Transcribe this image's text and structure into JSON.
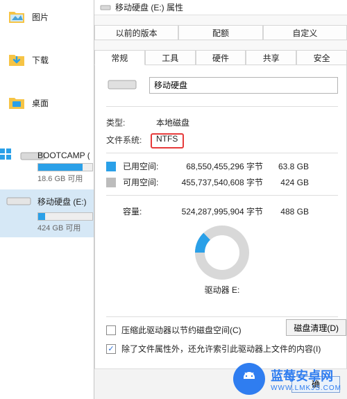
{
  "sidebar": {
    "nav": {
      "pictures": "图片",
      "downloads": "下载",
      "desktop": "桌面"
    },
    "drives": {
      "bootcamp": {
        "title": "BOOTCAMP (",
        "sub": "18.6 GB 可用",
        "fill_pct": 82
      },
      "removable": {
        "title": "移动硬盘 (E:)",
        "sub": "424 GB 可用",
        "fill_pct": 13
      }
    }
  },
  "dialog": {
    "title": "移动硬盘 (E:) 属性",
    "tabs_top": {
      "prev": "以前的版本",
      "quota": "配额",
      "custom": "自定义"
    },
    "tabs_bottom": {
      "general": "常规",
      "tools": "工具",
      "hardware": "硬件",
      "sharing": "共享",
      "security": "安全"
    },
    "name_value": "移动硬盘",
    "type_label": "类型:",
    "type_value": "本地磁盘",
    "fs_label": "文件系统:",
    "fs_value": "NTFS",
    "used_label": "已用空间:",
    "used_bytes": "68,550,455,296 字节",
    "used_human": "63.8 GB",
    "free_label": "可用空间:",
    "free_bytes": "455,737,540,608 字节",
    "free_human": "424 GB",
    "cap_label": "容量:",
    "cap_bytes": "524,287,995,904 字节",
    "cap_human": "488 GB",
    "drive_label": "驱动器 E:",
    "cleanup_btn": "磁盘清理(D)",
    "chk_compress": "压缩此驱动器以节约磁盘空间(C)",
    "chk_index": "除了文件属性外，还允许索引此驱动器上文件的内容(I)",
    "ok_btn": "确"
  },
  "chart_data": {
    "type": "pie",
    "title": "驱动器 E:",
    "series": [
      {
        "name": "已用空间",
        "value": 68550455296,
        "human": "63.8 GB",
        "color": "#2aa0e8"
      },
      {
        "name": "可用空间",
        "value": 455737540608,
        "human": "424 GB",
        "color": "#bcbcbc"
      }
    ],
    "total": {
      "value": 524287995904,
      "human": "488 GB"
    }
  },
  "icons": {
    "folder_color": "#f6c445",
    "accent": "#2aa0e8",
    "highlight": "#e63a3a"
  },
  "watermark": {
    "text": "蓝莓安卓网",
    "sub": "WWW.LMKJS.COM"
  }
}
